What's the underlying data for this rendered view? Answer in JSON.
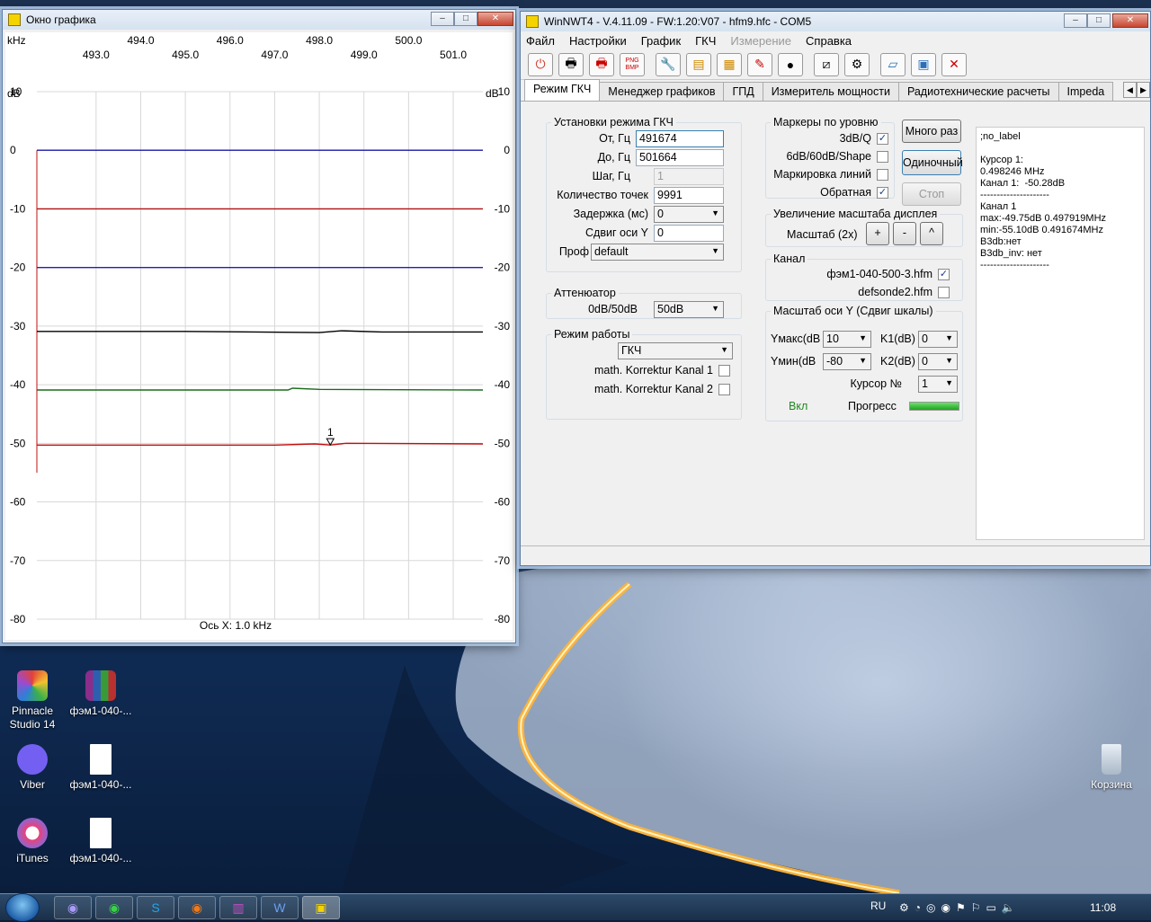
{
  "desktop": {
    "icons": [
      {
        "label": "Pinnacle Studio 14",
        "icon": "pinnacle-icon"
      },
      {
        "label": "фэм1-040-...",
        "icon": "winrar-archive-icon"
      },
      {
        "label": "Viber",
        "icon": "viber-icon"
      },
      {
        "label": "фэм1-040-...",
        "icon": "file-icon"
      },
      {
        "label": "iTunes",
        "icon": "itunes-icon"
      },
      {
        "label": "фэм1-040-...",
        "icon": "file-icon"
      },
      {
        "label": "Корзина",
        "icon": "recycle-bin-icon"
      }
    ]
  },
  "graph_window": {
    "title": "Окно графика",
    "unit_top": "kHz",
    "unit_left": "dB",
    "unit_right": "dB",
    "xaxis_caption": "Ось X: 1.0 kHz",
    "marker_label": "1"
  },
  "chart_data": {
    "type": "line",
    "x_ticks_top_row": [
      "494.0",
      "496.0",
      "498.0",
      "500.0"
    ],
    "x_ticks_bottom_row": [
      "493.0",
      "495.0",
      "497.0",
      "499.0",
      "501.0"
    ],
    "y_ticks": [
      "10",
      "0",
      "-10",
      "-20",
      "-30",
      "-40",
      "-50",
      "-60",
      "-70",
      "-80"
    ],
    "xlim": [
      491.674,
      501.664
    ],
    "ylim": [
      -80,
      10
    ],
    "grid": true,
    "series": [
      {
        "color": "#1a1aa8",
        "x": [
          491.674,
          501.664
        ],
        "y": [
          0,
          0
        ]
      },
      {
        "color": "#b01010",
        "x": [
          491.674,
          501.664
        ],
        "y": [
          -10,
          -10
        ]
      },
      {
        "color": "#2020b0",
        "x": [
          491.674,
          501.664
        ],
        "y": [
          -20,
          -20
        ]
      },
      {
        "color": "#000000",
        "x": [
          491.674,
          495.0,
          498.0,
          498.5,
          499.4,
          501.664
        ],
        "y": [
          -30.9,
          -30.9,
          -31.1,
          -30.8,
          -31.0,
          -31.0
        ]
      },
      {
        "color": "#1a6a1a",
        "x": [
          491.674,
          496.0,
          497.3,
          497.4,
          498.0,
          501.664
        ],
        "y": [
          -40.9,
          -40.9,
          -40.9,
          -40.6,
          -40.8,
          -40.9
        ]
      },
      {
        "color": "#c01010",
        "x": [
          491.674,
          497.0,
          497.9,
          498.246,
          498.6,
          501.664
        ],
        "y": [
          -50.3,
          -50.3,
          -50.1,
          -50.28,
          -50.0,
          -50.1
        ]
      }
    ]
  },
  "main_window": {
    "title": "WinNWT4 - V.4.11.09 - FW:1.20:V07 - hfm9.hfc - COM5",
    "menu": [
      {
        "label": "Файл",
        "enabled": true
      },
      {
        "label": "Настройки",
        "enabled": true
      },
      {
        "label": "График",
        "enabled": true
      },
      {
        "label": "ГКЧ",
        "enabled": true
      },
      {
        "label": "Измерение",
        "enabled": false
      },
      {
        "label": "Справка",
        "enabled": true
      }
    ],
    "toolbar": [
      "power-icon",
      "print-icon",
      "print-color-icon",
      "png-bmp-icon",
      "tools-icon",
      "chart-icon",
      "db-icon",
      "probe-icon",
      "linux-icon",
      "sweep-icon",
      "sweep-settings-icon",
      "open-folder-icon",
      "save-icon",
      "clear-icon"
    ],
    "png_label": "PNG BMP",
    "tabs": [
      "Режим ГКЧ",
      "Менеджер графиков",
      "ГПД",
      "Измеритель мощности",
      "Радиотехнические расчеты",
      "Impeda"
    ],
    "sweep_group": {
      "legend": "Установки режима ГКЧ",
      "from_label": "От, Гц",
      "from_value": "491674",
      "to_label": "До, Гц",
      "to_value": "501664",
      "step_label": "Шаг, Гц",
      "step_value": "1",
      "points_label": "Количество точек",
      "points_value": "9991",
      "delay_label": "Задержка (мс)",
      "delay_value": "0",
      "yshift_label": "Сдвиг оси Y",
      "yshift_value": "0",
      "profile_label": "Проф",
      "profile_value": "default"
    },
    "attenuator": {
      "legend": "Аттенюатор",
      "label": "0dB/50dB",
      "value": "50dB"
    },
    "mode": {
      "legend": "Режим работы",
      "value": "ГКЧ",
      "kanal1_label": "math. Korrektur Kanal 1",
      "kanal2_label": "math. Korrektur Kanal 2"
    },
    "markers": {
      "legend": "Маркеры по уровню",
      "items": [
        {
          "label": "3dB/Q",
          "checked": true
        },
        {
          "label": "6dB/60dB/Shape",
          "checked": false
        },
        {
          "label": "Маркировка линий",
          "checked": false
        },
        {
          "label": "Обратная",
          "checked": true
        }
      ]
    },
    "buttons": {
      "many": "Много раз",
      "single": "Одиночный",
      "stop": "Стоп"
    },
    "zoom": {
      "legend": "Увеличение масштаба дисплея",
      "label": "Масштаб (2x)",
      "plus": "+",
      "minus": "-",
      "caret": "^"
    },
    "channel": {
      "legend": "Канал",
      "items": [
        {
          "label": "фэм1-040-500-3.hfm",
          "checked": true
        },
        {
          "label": "defsonde2.hfm",
          "checked": false
        }
      ]
    },
    "yscale": {
      "legend": "Масштаб оси Y (Сдвиг шкалы)",
      "ymax_label": "Yмакс(dB",
      "ymax_value": "10",
      "ymin_label": "Yмин(dB",
      "ymin_value": "-80",
      "k1_label": "K1(dB)",
      "k1_value": "0",
      "k2_label": "K2(dB)",
      "k2_value": "0",
      "cursor_label": "Курсор №",
      "cursor_value": "1",
      "on_label": "Вкл",
      "progress_label": "Прогресс",
      "progress": 1.0
    },
    "info": [
      ";no_label",
      "",
      "Курсор 1:",
      "0.498246 MHz",
      "Канал 1:  -50.28dB",
      "---------------------",
      "Канал 1",
      "max:-49.75dB 0.497919MHz",
      "min:-55.10dB 0.491674MHz",
      "B3db:нет",
      "B3db_inv: нет",
      "---------------------"
    ]
  },
  "taskbar": {
    "items": [
      "viber-icon",
      "whatsapp-icon",
      "skype-icon",
      "firefox-icon",
      "winrar-icon",
      "word-icon",
      "winnwt-icon"
    ],
    "lang": "RU",
    "time": "11:08"
  }
}
